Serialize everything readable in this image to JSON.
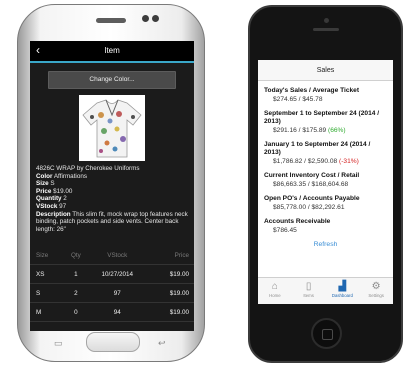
{
  "android": {
    "header": {
      "back_icon": "chevron-left-icon",
      "title": "Item"
    },
    "change_color_label": "Change Color...",
    "product": {
      "title": "4826C WRAP by Cherokee Uniforms",
      "color_label": "Color",
      "color_value": "Affirmations",
      "size_label": "Size",
      "size_value": "S",
      "price_label": "Price",
      "price_value": "$19.00",
      "quantity_label": "Quantity",
      "quantity_value": "2",
      "vstock_label": "VStock",
      "vstock_value": "97",
      "description_label": "Description",
      "description_value": "This slim fit, mock wrap top features neck binding, patch pockets and side vents. Center back length: 26\""
    },
    "table": {
      "headers": [
        "Size",
        "Qty",
        "VStock",
        "Price"
      ],
      "rows": [
        [
          "XS",
          "1",
          "10/27/2014",
          "$19.00"
        ],
        [
          "S",
          "2",
          "97",
          "$19.00"
        ],
        [
          "M",
          "0",
          "94",
          "$19.00"
        ]
      ]
    }
  },
  "iphone": {
    "header_title": "Sales",
    "sections": [
      {
        "label": "Today's Sales / Average Ticket",
        "value": "$274.65 / $45.78",
        "change": ""
      },
      {
        "label": "September 1 to September 24 (2014 / 2013)",
        "value": "$291.16 / $175.89",
        "change": "(66%)"
      },
      {
        "label": "January 1 to September 24 (2014 / 2013)",
        "value": "$1,786.82 / $2,590.08",
        "change": "(-31%)"
      },
      {
        "label": "Current Inventory Cost / Retail",
        "value": "$86,663.35 / $168,604.68",
        "change": ""
      },
      {
        "label": "Open PO's / Accounts Payable",
        "value": "$85,778.00 / $82,292.61",
        "change": ""
      },
      {
        "label": "Accounts Receivable",
        "value": "$786.45",
        "change": ""
      }
    ],
    "refresh_label": "Refresh",
    "tabs": [
      {
        "label": "Home",
        "icon": "home-icon"
      },
      {
        "label": "Items",
        "icon": "clipboard-icon"
      },
      {
        "label": "Dashboard",
        "icon": "dashboard-icon"
      },
      {
        "label": "Settings",
        "icon": "gear-icon"
      }
    ],
    "active_tab": "Dashboard"
  },
  "colors": {
    "android_accent": "#3aa7c8",
    "positive": "#2eaa2e",
    "negative": "#d42222",
    "link": "#3b8fd6",
    "active_tab": "#1f67b1"
  }
}
